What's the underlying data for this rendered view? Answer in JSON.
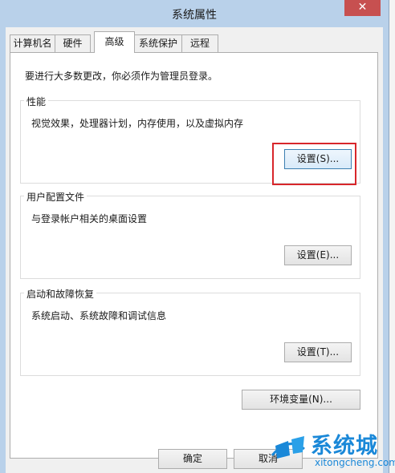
{
  "window": {
    "title": "系统属性",
    "close_glyph": "✕"
  },
  "tabs": [
    {
      "label": "计算机名",
      "active": false
    },
    {
      "label": "硬件",
      "active": false
    },
    {
      "label": "高级",
      "active": true
    },
    {
      "label": "系统保护",
      "active": false
    },
    {
      "label": "远程",
      "active": false
    }
  ],
  "note": "要进行大多数更改，你必须作为管理员登录。",
  "groups": {
    "performance": {
      "label": "性能",
      "desc": "视觉效果，处理器计划，内存使用，以及虚拟内存",
      "button": "设置(S)..."
    },
    "profiles": {
      "label": "用户配置文件",
      "desc": "与登录帐户相关的桌面设置",
      "button": "设置(E)..."
    },
    "startup": {
      "label": "启动和故障恢复",
      "desc": "系统启动、系统故障和调试信息",
      "button": "设置(T)..."
    }
  },
  "env_button": "环境变量(N)...",
  "footer": {
    "ok": "确定",
    "cancel": "取消"
  },
  "watermark": {
    "text": "系统城",
    "url": "xitongcheng.com"
  },
  "colors": {
    "highlight": "#d8262b",
    "close": "#c75050",
    "frame": "#b9d1ea",
    "watermark": "#1a88d8"
  }
}
